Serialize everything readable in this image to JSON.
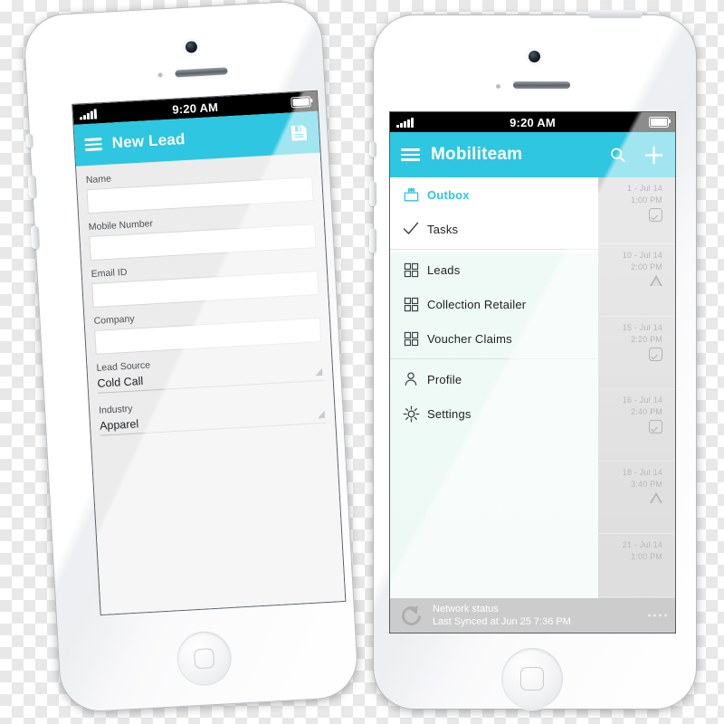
{
  "left_phone": {
    "status_bar": {
      "time": "9:20 AM",
      "signal_icon": "signal-bars-icon",
      "battery_icon": "battery-full-icon"
    },
    "app_bar": {
      "menu_icon": "hamburger-menu-icon",
      "title": "New Lead",
      "save_icon": "save-floppy-disk-icon"
    },
    "fields": [
      {
        "label": "Name",
        "value": "",
        "type": "text"
      },
      {
        "label": "Mobile Number",
        "value": "",
        "type": "text"
      },
      {
        "label": "Email ID",
        "value": "",
        "type": "text"
      },
      {
        "label": "Company",
        "value": "",
        "type": "text"
      },
      {
        "label": "Lead Source",
        "value": "Cold Call",
        "type": "select"
      },
      {
        "label": "Industry",
        "value": "Apparel",
        "type": "select"
      }
    ]
  },
  "right_phone": {
    "status_bar": {
      "time": "9:20 AM",
      "signal_icon": "signal-bars-icon",
      "battery_icon": "battery-full-icon"
    },
    "app_bar": {
      "menu_icon": "hamburger-menu-icon",
      "title": "Mobiliteam",
      "search_icon": "search-icon",
      "add_icon": "plus-icon"
    },
    "drawer_items": [
      {
        "label": "Outbox",
        "icon": "outbox-tray-icon",
        "active": true
      },
      {
        "label": "Tasks",
        "icon": "checkmark-icon",
        "active": false
      },
      {
        "label": "Leads",
        "icon": "grid-squares-icon",
        "active": false
      },
      {
        "label": "Collection Retailer",
        "icon": "grid-squares-icon",
        "active": false
      },
      {
        "label": "Voucher Claims",
        "icon": "grid-squares-icon",
        "active": false
      },
      {
        "label": "Profile",
        "icon": "person-icon",
        "active": false
      },
      {
        "label": "Settings",
        "icon": "gear-icon",
        "active": false
      }
    ],
    "background_list": [
      {
        "date": "1 - Jul 14",
        "time": "1:00 PM",
        "status_icon": "checkbox-checked-icon"
      },
      {
        "date": "10 - Jul 14",
        "time": "2:00 PM",
        "status_icon": "warning-triangle-icon"
      },
      {
        "date": "15 - Jul 14",
        "time": "2:20 PM",
        "status_icon": "checkbox-checked-icon"
      },
      {
        "date": "16 - Jul 14",
        "time": "2:40 PM",
        "status_icon": "checkbox-checked-icon"
      },
      {
        "date": "18 - Jul 14",
        "time": "3:40 PM",
        "status_icon": "warning-triangle-icon"
      },
      {
        "date": "21 - Jul 14",
        "time": "1:00 PM",
        "status_icon": ""
      }
    ],
    "network_status": {
      "refresh_icon": "refresh-sync-icon",
      "title": "Network status",
      "subtitle": "Last Synced at Jun 25  7:36 PM"
    }
  },
  "colors": {
    "accent_cyan": "#2ec6e0",
    "drawer_bg": "#eef9f5",
    "form_bg": "#ececec",
    "status_bar_bg": "#000000",
    "network_bar_bg": "#8d8d8d"
  }
}
